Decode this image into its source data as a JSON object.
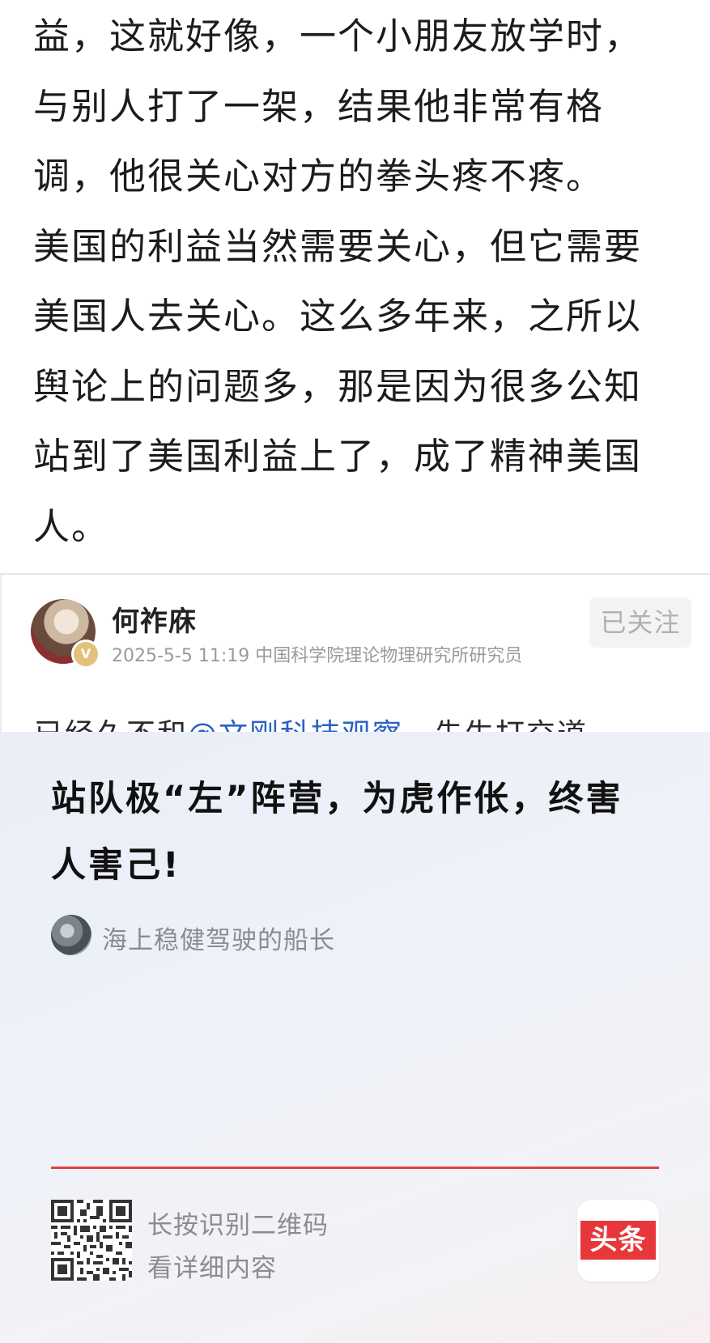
{
  "article": {
    "lines": [
      "益，这就好像，一个小朋友放学时，",
      "与别人打了一架，结果他非常有格",
      "调，他很关心对方的拳头疼不疼。",
      "美国的利益当然需要关心，但它需要",
      "美国人去关心。这么多年来，之所以",
      "舆论上的问题多，那是因为很多公知",
      "站到了美国利益上了，成了精神美国",
      "人。"
    ]
  },
  "comment": {
    "author_name": "何祚庥",
    "verified_badge": "V",
    "meta": "2025-5-5 11:19 中国科学院理论物理研究所研究员",
    "follow_label": "已关注",
    "partial_text_prefix": "已经久不和",
    "partial_mention": "@文刚科技观察",
    "partial_text_suffix": "…先生打交道"
  },
  "share_card": {
    "title": "站队极“左”阵营，为虎作伥，终害人害己!",
    "author_name": "海上稳健驾驶的船长",
    "qr_hint_line1": "长按识别二维码",
    "qr_hint_line2": "看详细内容",
    "logo_text": "头条",
    "accent_color": "#e0443b",
    "logo_color": "#e8373b"
  },
  "icons": {
    "comment_avatar": "user-avatar-icon",
    "verified": "verified-badge-icon",
    "share_author_avatar": "author-avatar-icon",
    "qr": "qr-code-icon",
    "brand_logo": "toutiao-logo-icon"
  }
}
